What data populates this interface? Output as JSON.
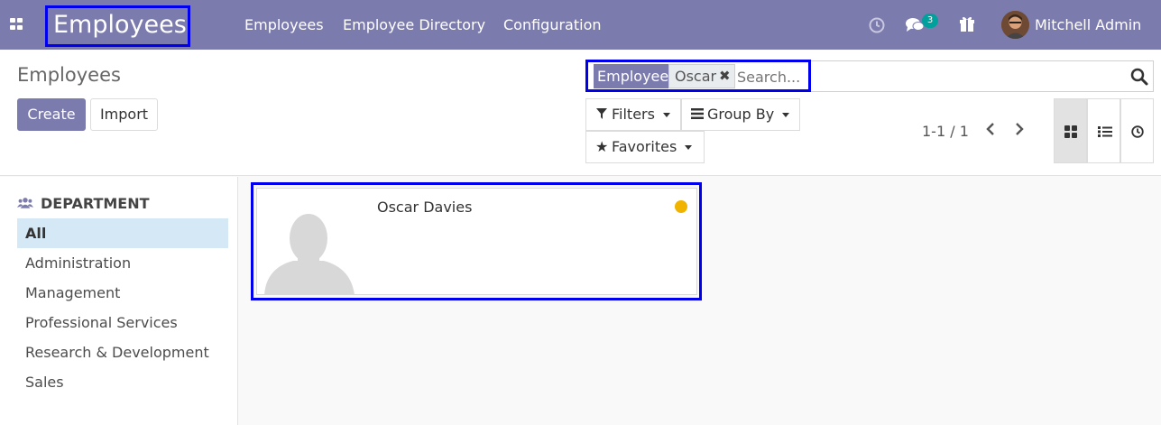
{
  "navbar": {
    "app_title": "Employees",
    "menu": [
      "Employees",
      "Employee Directory",
      "Configuration"
    ],
    "messages_count": "3",
    "user_name": "Mitchell Admin",
    "background_color": "#7c7bad"
  },
  "control_panel": {
    "breadcrumb": "Employees",
    "create_label": "Create",
    "import_label": "Import",
    "search": {
      "facet_label": "Employee",
      "facet_value": "Oscar",
      "placeholder": "Search..."
    },
    "filters_label": "Filters",
    "group_by_label": "Group By",
    "favorites_label": "Favorites",
    "pager": "1-1 / 1",
    "views": [
      "kanban",
      "list",
      "activity"
    ],
    "active_view": "kanban"
  },
  "side_panel": {
    "header": "DEPARTMENT",
    "items": [
      {
        "label": "All",
        "active": true
      },
      {
        "label": "Administration"
      },
      {
        "label": "Management"
      },
      {
        "label": "Professional Services"
      },
      {
        "label": "Research & Development"
      },
      {
        "label": "Sales"
      }
    ]
  },
  "kanban": {
    "cards": [
      {
        "name": "Oscar Davies",
        "status_color": "#f0b400"
      }
    ]
  }
}
